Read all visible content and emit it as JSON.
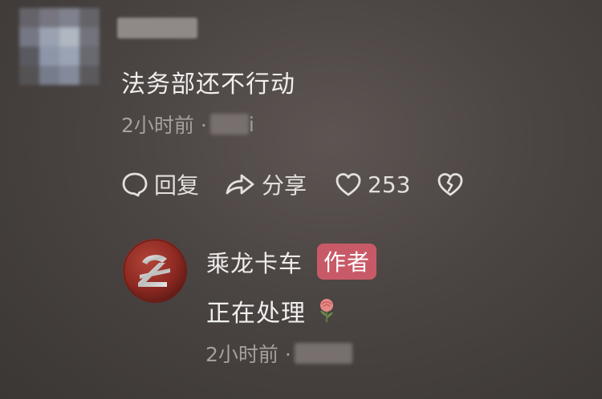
{
  "comment": {
    "text": "法务部还不行动",
    "time": "2小时前 ·",
    "location_trail": "i",
    "actions": {
      "reply_label": "回复",
      "share_label": "分享",
      "like_count": "253"
    }
  },
  "reply": {
    "name": "乘龙卡车",
    "badge": "作者",
    "text": "正在处理",
    "time": "2小时前 ·"
  },
  "colors": {
    "badge_bg": "#c85a67",
    "avatar_red": "#8f2a22",
    "text_primary": "#f1efee",
    "text_secondary": "#a5a09e"
  },
  "icons": {
    "reply": "speech-bubble-icon",
    "share": "share-arrow-icon",
    "like": "heart-outline-icon",
    "dislike": "broken-heart-icon",
    "rose": "rose-emoji-icon"
  }
}
